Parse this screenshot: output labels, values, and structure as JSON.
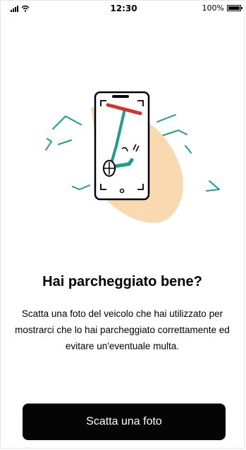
{
  "status_bar": {
    "time": "12:30",
    "battery": "100%"
  },
  "icons": {
    "signal": "cellular-signal-icon",
    "wifi": "wifi-icon",
    "battery": "battery-icon",
    "illustration": "phone-photographing-scooter-illustration"
  },
  "main": {
    "title": "Hai parcheggiato bene?",
    "description": "Scatta una foto del veicolo che hai utilizzato per mostrarci che lo hai parcheggiato correttamente ed evitare un'eventuale multa."
  },
  "cta": {
    "label": "Scatta una foto"
  },
  "colors": {
    "accent_green": "#1e9e8a",
    "accent_red": "#d6332e",
    "hand_skin": "#f8d9b0",
    "button_background": "#050505"
  }
}
